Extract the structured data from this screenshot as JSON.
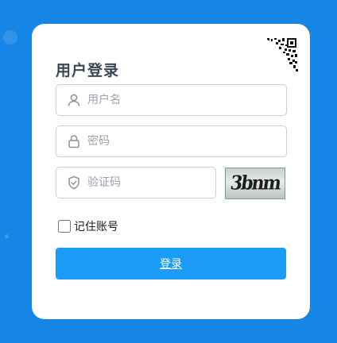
{
  "login": {
    "title": "用户登录",
    "username_placeholder": "用户名",
    "password_placeholder": "密码",
    "captcha_placeholder": "验证码",
    "captcha_text": "3bnm",
    "remember_label": "记住账号",
    "remember_checked": false,
    "submit_label": "登录"
  },
  "colors": {
    "page_background": "#1686e6",
    "card_background": "#ffffff",
    "primary_button": "#1a9bf5",
    "title_text": "#3a4656"
  },
  "icons": {
    "qr_corner": "qr-code-icon",
    "username": "user-icon",
    "password": "lock-icon",
    "captcha": "shield-check-icon"
  }
}
